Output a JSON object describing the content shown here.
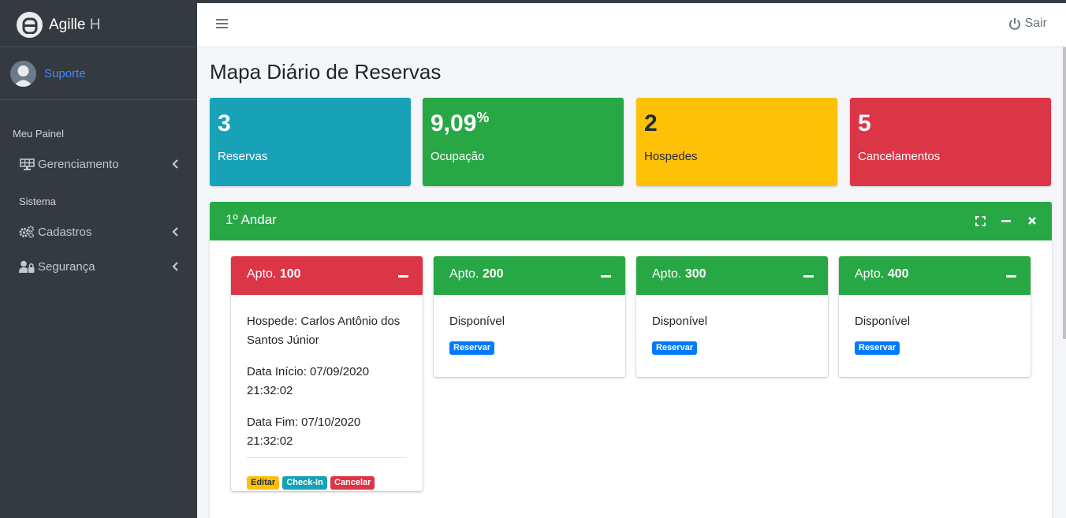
{
  "brand": {
    "name": "Agille",
    "suffix": " H"
  },
  "user": {
    "name": "Suporte"
  },
  "sidebar": {
    "headers": [
      "Meu Painel",
      "Sistema"
    ],
    "items": [
      {
        "label": "Gerenciamento",
        "icon": "solar-panel-icon"
      },
      {
        "label": "Cadastros",
        "icon": "cogs-icon"
      },
      {
        "label": "Segurança",
        "icon": "user-lock-icon"
      }
    ]
  },
  "navbar": {
    "logout_label": "Sair"
  },
  "page": {
    "title": "Mapa Diário de Reservas"
  },
  "stats": [
    {
      "value": "3",
      "suffix": "",
      "label": "Reservas",
      "color": "#17a2b8"
    },
    {
      "value": "9,09",
      "suffix": "%",
      "label": "Ocupação",
      "color": "#28a745"
    },
    {
      "value": "2",
      "suffix": "",
      "label": "Hospedes",
      "color": "#ffc107"
    },
    {
      "value": "5",
      "suffix": "",
      "label": "Cancelamentos",
      "color": "#dc3545"
    }
  ],
  "floor": {
    "title": "1º Andar"
  },
  "rooms": [
    {
      "prefix": "Apto. ",
      "number": "100",
      "status_color": "#dc3545",
      "guest": "Hospede: Carlos Antônio dos Santos Júnior",
      "start": "Data Início: 07/09/2020 21:32:02",
      "end": "Data Fim: 07/10/2020 21:32:02",
      "actions": [
        "Editar",
        "Check-In",
        "Cancelar"
      ]
    },
    {
      "prefix": "Apto. ",
      "number": "200",
      "status_color": "#28a745",
      "status": "Disponível",
      "action": "Reservar"
    },
    {
      "prefix": "Apto. ",
      "number": "300",
      "status_color": "#28a745",
      "status": "Disponível",
      "action": "Reservar"
    },
    {
      "prefix": "Apto. ",
      "number": "400",
      "status_color": "#28a745",
      "status": "Disponível",
      "action": "Reservar"
    }
  ]
}
